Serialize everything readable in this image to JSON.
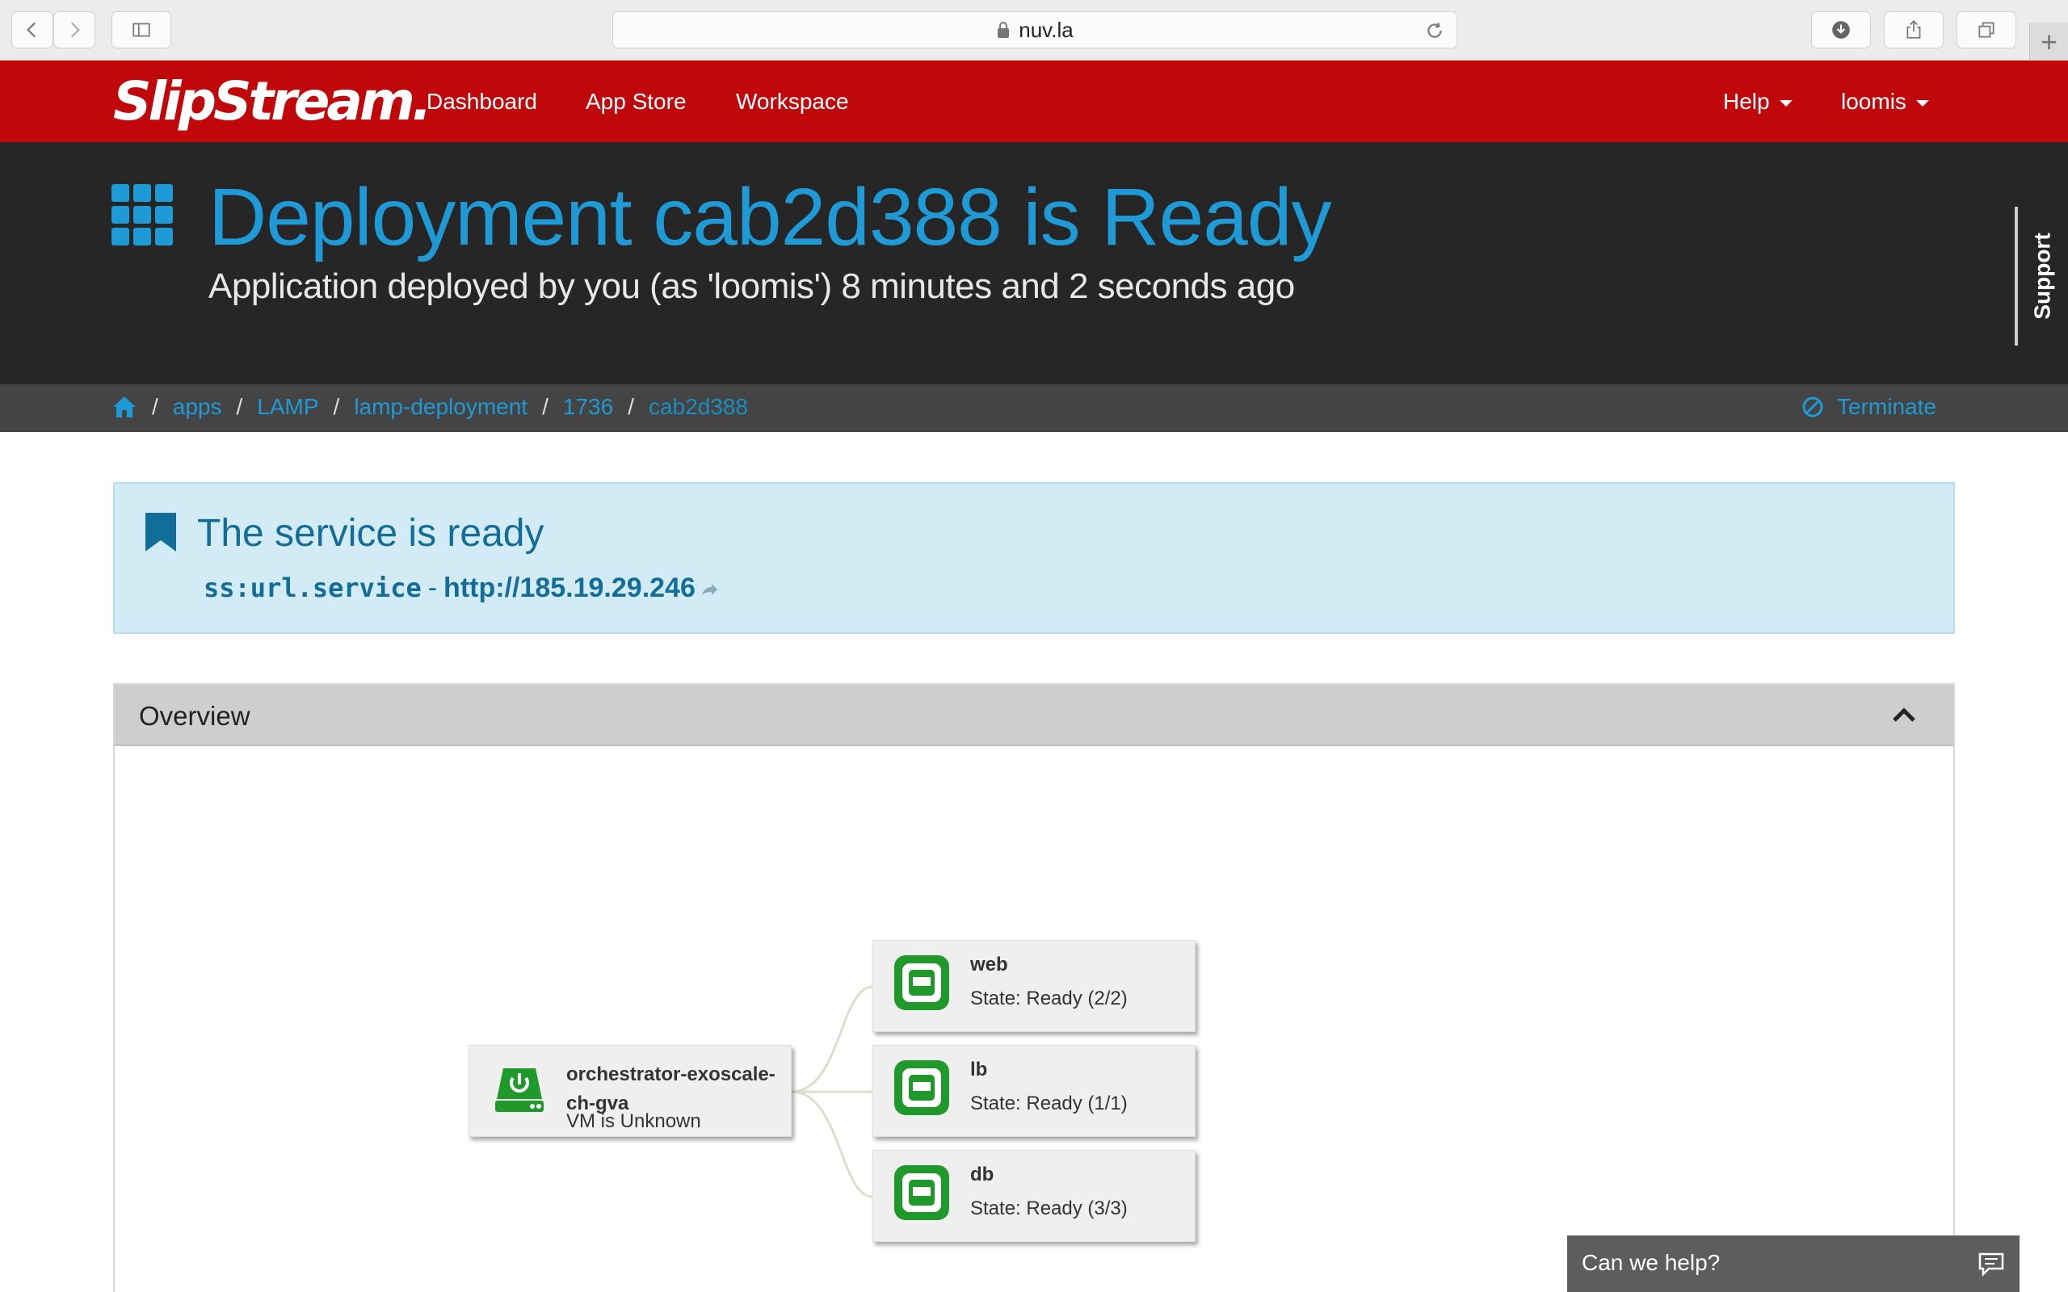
{
  "browser": {
    "url": "nuv.la",
    "icons": [
      "back-icon",
      "forward-icon",
      "sidebar-icon",
      "lock-icon",
      "reload-icon",
      "download-icon",
      "share-icon",
      "tabs-icon",
      "new-tab-icon"
    ]
  },
  "nav": {
    "logo": "SlipStream.",
    "links": [
      "Dashboard",
      "App Store",
      "Workspace"
    ],
    "help": "Help",
    "user": "loomis"
  },
  "header": {
    "title": "Deployment cab2d388 is Ready",
    "subtitle": "Application deployed by you (as 'loomis') 8 minutes and 2 seconds ago",
    "support": "Support"
  },
  "breadcrumb": {
    "items": [
      "apps",
      "LAMP",
      "lamp-deployment",
      "1736"
    ],
    "current": "cab2d388",
    "terminate": "Terminate"
  },
  "alert": {
    "title": "The service is ready",
    "key": "ss:url.service",
    "separator": "-",
    "url": "http://185.19.29.246"
  },
  "overview": {
    "title": "Overview",
    "orchestrator": {
      "name": "orchestrator-exoscale-ch-gva",
      "state": "VM is Unknown"
    },
    "nodes": [
      {
        "name": "web",
        "state": "State: Ready (2/2)"
      },
      {
        "name": "lb",
        "state": "State: Ready (1/1)"
      },
      {
        "name": "db",
        "state": "State: Ready (3/3)"
      }
    ]
  },
  "chat": {
    "label": "Can we help?"
  },
  "colors": {
    "brand_red": "#c0080b",
    "accent_blue": "#1e9ad6",
    "ready_green": "#1f9a2a"
  }
}
